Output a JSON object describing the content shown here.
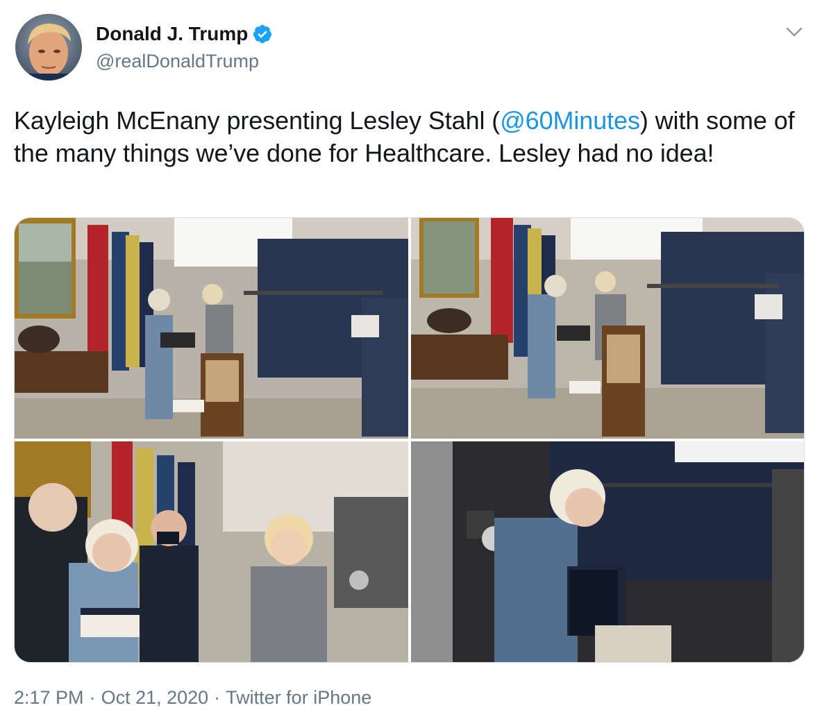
{
  "author": {
    "display_name": "Donald J. Trump",
    "handle": "@realDonaldTrump",
    "verified": true,
    "avatar_icon": "profile-photo"
  },
  "tweet": {
    "text_before": "Kayleigh McEnany presenting Lesley Stahl (",
    "mention": "@60Minutes",
    "text_after": ") with some of the many things we’ve done for Healthcare. Lesley had no idea!",
    "time": "2:17 PM",
    "date": "Oct 21, 2020",
    "source": "Twitter for iPhone",
    "separator": "·"
  },
  "media": {
    "photo_count": 4
  },
  "colors": {
    "link": "#1b95e0",
    "secondary_text": "#657786",
    "verified_badge": "#1da1f2"
  },
  "icons": {
    "verified": "verified-badge-icon",
    "more": "chevron-down-icon"
  }
}
